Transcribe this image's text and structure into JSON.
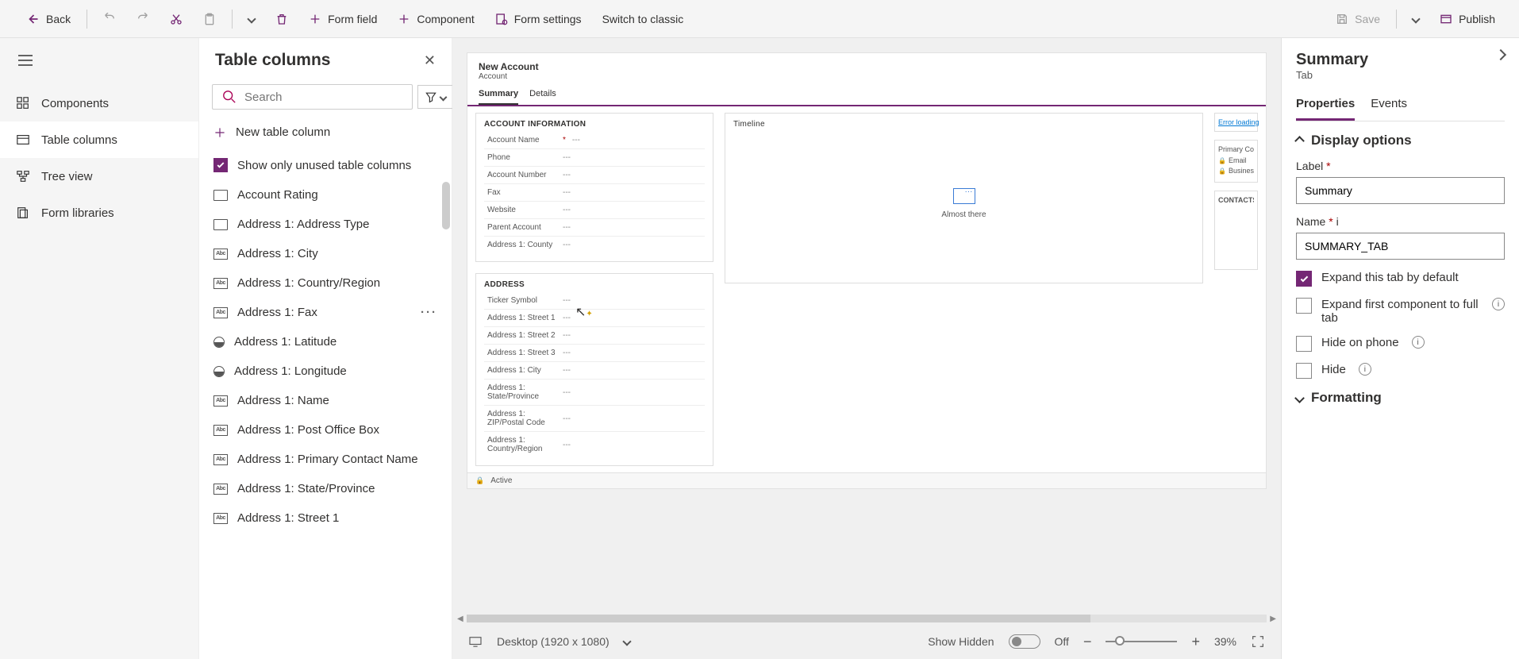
{
  "toolbar": {
    "back": "Back",
    "form_field": "Form field",
    "component": "Component",
    "form_settings": "Form settings",
    "switch_classic": "Switch to classic",
    "save": "Save",
    "publish": "Publish"
  },
  "nav": {
    "components": "Components",
    "table_columns": "Table columns",
    "tree_view": "Tree view",
    "form_libraries": "Form libraries"
  },
  "columns_panel": {
    "title": "Table columns",
    "search_placeholder": "Search",
    "new_column": "New table column",
    "show_unused": "Show only unused table columns",
    "items": [
      {
        "label": "Account Rating",
        "type": "rect"
      },
      {
        "label": "Address 1: Address Type",
        "type": "rect"
      },
      {
        "label": "Address 1: City",
        "type": "abc"
      },
      {
        "label": "Address 1: Country/Region",
        "type": "abc"
      },
      {
        "label": "Address 1: Fax",
        "type": "abc",
        "hovered": true
      },
      {
        "label": "Address 1: Latitude",
        "type": "globe"
      },
      {
        "label": "Address 1: Longitude",
        "type": "globe"
      },
      {
        "label": "Address 1: Name",
        "type": "abc"
      },
      {
        "label": "Address 1: Post Office Box",
        "type": "abc"
      },
      {
        "label": "Address 1: Primary Contact Name",
        "type": "abc"
      },
      {
        "label": "Address 1: State/Province",
        "type": "abc"
      },
      {
        "label": "Address 1: Street 1",
        "type": "abc"
      }
    ]
  },
  "form": {
    "title": "New Account",
    "subtitle": "Account",
    "tabs": [
      {
        "label": "Summary",
        "active": true
      },
      {
        "label": "Details",
        "active": false
      }
    ],
    "sections": {
      "account_info": {
        "title": "ACCOUNT INFORMATION",
        "fields": [
          {
            "label": "Account Name",
            "required": true,
            "value": "---"
          },
          {
            "label": "Phone",
            "value": "---"
          },
          {
            "label": "Account Number",
            "value": "---"
          },
          {
            "label": "Fax",
            "value": "---"
          },
          {
            "label": "Website",
            "value": "---"
          },
          {
            "label": "Parent Account",
            "value": "---"
          },
          {
            "label": "Address 1: County",
            "value": "---"
          }
        ]
      },
      "address": {
        "title": "ADDRESS",
        "fields": [
          {
            "label": "Ticker Symbol",
            "value": "---"
          },
          {
            "label": "Address 1: Street 1",
            "value": "---"
          },
          {
            "label": "Address 1: Street 2",
            "value": "---"
          },
          {
            "label": "Address 1: Street 3",
            "value": "---"
          },
          {
            "label": "Address 1: City",
            "value": "---"
          },
          {
            "label": "Address 1: State/Province",
            "value": "---"
          },
          {
            "label": "Address 1: ZIP/Postal Code",
            "value": "---"
          },
          {
            "label": "Address 1: Country/Region",
            "value": "---"
          }
        ]
      },
      "timeline": {
        "title": "Timeline",
        "status": "Almost there"
      }
    },
    "right_strip": {
      "error": "Error loading",
      "primary_contact": "Primary Co",
      "email": "Email",
      "business": "Business",
      "contacts": "CONTACTS"
    },
    "footer_status": "Active"
  },
  "canvas_footer": {
    "device": "Desktop (1920 x 1080)",
    "show_hidden": "Show Hidden",
    "toggle_state": "Off",
    "zoom": "39%"
  },
  "properties": {
    "title": "Summary",
    "subtitle": "Tab",
    "tabs": [
      {
        "label": "Properties",
        "active": true
      },
      {
        "label": "Events",
        "active": false
      }
    ],
    "display_options": "Display options",
    "label_field": {
      "label": "Label",
      "value": "Summary"
    },
    "name_field": {
      "label": "Name",
      "value": "SUMMARY_TAB"
    },
    "expand_default": "Expand this tab by default",
    "expand_first": "Expand first component to full tab",
    "hide_phone": "Hide on phone",
    "hide": "Hide",
    "formatting": "Formatting"
  }
}
